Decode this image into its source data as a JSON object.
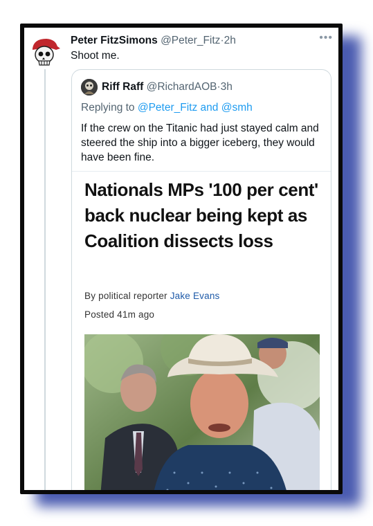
{
  "tweet": {
    "author_name": "Peter FitzSimons",
    "author_handle": "@Peter_Fitz",
    "separator": "·",
    "time": "2h",
    "text": "Shoot me.",
    "more_icon": "more-icon"
  },
  "quoted_tweet": {
    "author_name": "Riff Raff",
    "author_handle": "@RichardAOB",
    "separator": "·",
    "time": "3h",
    "replying_prefix": "Replying to",
    "replying_mention_1": "@Peter_Fitz",
    "replying_and": "and",
    "replying_mention_2": "@smh",
    "text": "If the crew on the Titanic had just stayed calm and steered the ship into a bigger iceberg, they would have been fine."
  },
  "article": {
    "headline": "Nationals MPs '100 per cent' back nuclear being kept as Coalition dissects loss",
    "byline_prefix": "By political reporter",
    "reporter": "Jake Evans",
    "posted": "Posted 41m ago"
  },
  "colors": {
    "frame": "#0a0a0a",
    "shadow": "#4a5bb0",
    "link": "#1d9bf0",
    "reporter_link": "#1e5aa8",
    "muted": "#536471"
  }
}
